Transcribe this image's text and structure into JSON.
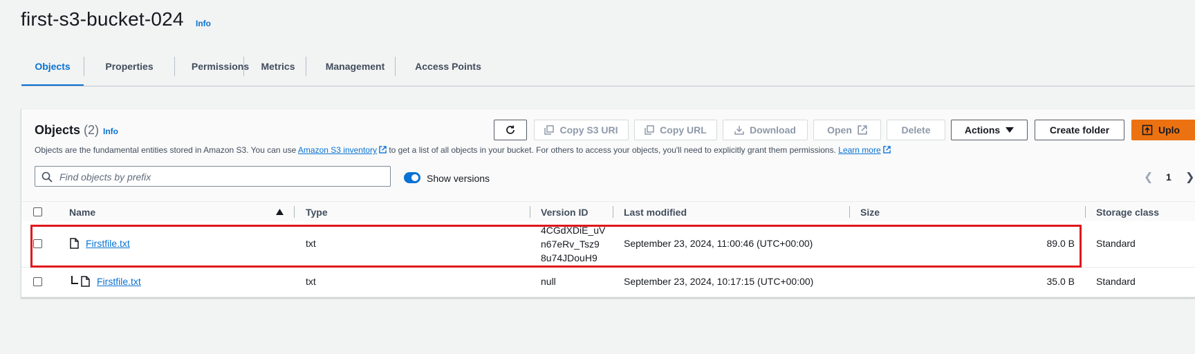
{
  "header": {
    "bucket_name": "first-s3-bucket-024",
    "info": "Info"
  },
  "tabs": [
    {
      "label": "Objects",
      "active": true
    },
    {
      "label": "Properties"
    },
    {
      "label": "Permissions"
    },
    {
      "label": "Metrics"
    },
    {
      "label": "Management"
    },
    {
      "label": "Access Points"
    }
  ],
  "objects_panel": {
    "title": "Objects",
    "count": "(2)",
    "info": "Info",
    "description": {
      "prefix": "Objects are the fundamental entities stored in Amazon S3. You can use",
      "inventory_link": "Amazon S3 inventory",
      "middle": "to get a list of all objects in your bucket. For others to access your objects, you'll need to explicitly grant them permissions.",
      "learn_more": "Learn more"
    },
    "toolbar": {
      "refresh_icon": "refresh-icon",
      "copy_s3_uri": "Copy S3 URI",
      "copy_url": "Copy URL",
      "download": "Download",
      "open": "Open",
      "delete": "Delete",
      "actions": "Actions",
      "create_folder": "Create folder",
      "upload": "Uplo"
    },
    "search": {
      "placeholder": "Find objects by prefix",
      "value": ""
    },
    "show_versions": {
      "label": "Show versions",
      "enabled": true
    },
    "pagination": {
      "current_page": "1"
    }
  },
  "table": {
    "columns": [
      "Name",
      "Type",
      "Version ID",
      "Last modified",
      "Size",
      "Storage class"
    ],
    "rows": [
      {
        "name": "Firstfile.txt",
        "type": "txt",
        "version_id_lines": [
          "4CGdXDiE_uV",
          "n67eRv_Tsz9",
          "8u74JDouH9"
        ],
        "last_modified": "September 23, 2024, 11:00:46 (UTC+00:00)",
        "size": "89.0 B",
        "storage_class": "Standard",
        "highlighted": true
      },
      {
        "name": "Firstfile.txt",
        "type": "txt",
        "version_id": "null",
        "last_modified": "September 23, 2024, 10:17:15 (UTC+00:00)",
        "size": "35.0 B",
        "storage_class": "Standard",
        "is_prior_version": true
      }
    ]
  },
  "colors": {
    "accent": "#0972d3",
    "primary_button": "#ec7211",
    "highlight_box": "#e0161b"
  }
}
